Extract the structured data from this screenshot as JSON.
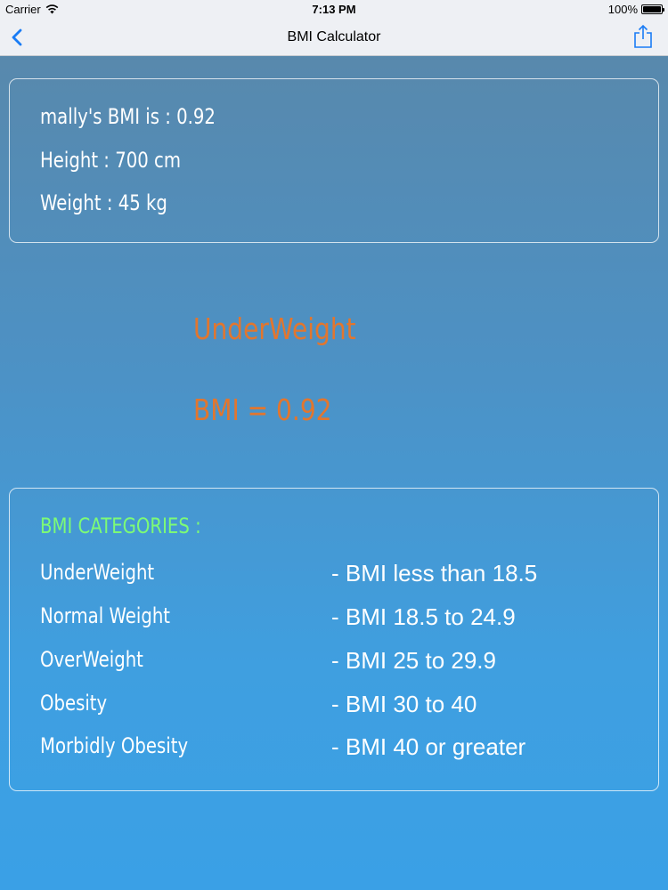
{
  "status": {
    "carrier": "Carrier",
    "time": "7:13 PM",
    "battery": "100%",
    "battery_level": 1.0
  },
  "nav": {
    "title": "BMI Calculator",
    "back_icon": "chevron-left-icon",
    "share_icon": "share-icon"
  },
  "info": {
    "bmi_line": "mally's BMI is : 0.92",
    "height_line": "Height : 700 cm",
    "weight_line": "Weight : 45 kg"
  },
  "result": {
    "category": "UnderWeight",
    "bmi_line": "BMI = 0.92",
    "color": "#e2762e"
  },
  "categories": {
    "title": "BMI CATEGORIES :",
    "title_color": "#7dfb76",
    "items": [
      {
        "name": "UnderWeight",
        "range": "- BMI less than 18.5"
      },
      {
        "name": "Normal Weight",
        "range": "- BMI 18.5 to 24.9"
      },
      {
        "name": "OverWeight",
        "range": "- BMI 25 to 29.9"
      },
      {
        "name": "Obesity",
        "range": "- BMI 30 to 40"
      },
      {
        "name": "Morbidly Obesity",
        "range": "- BMI 40 or greater"
      }
    ]
  }
}
